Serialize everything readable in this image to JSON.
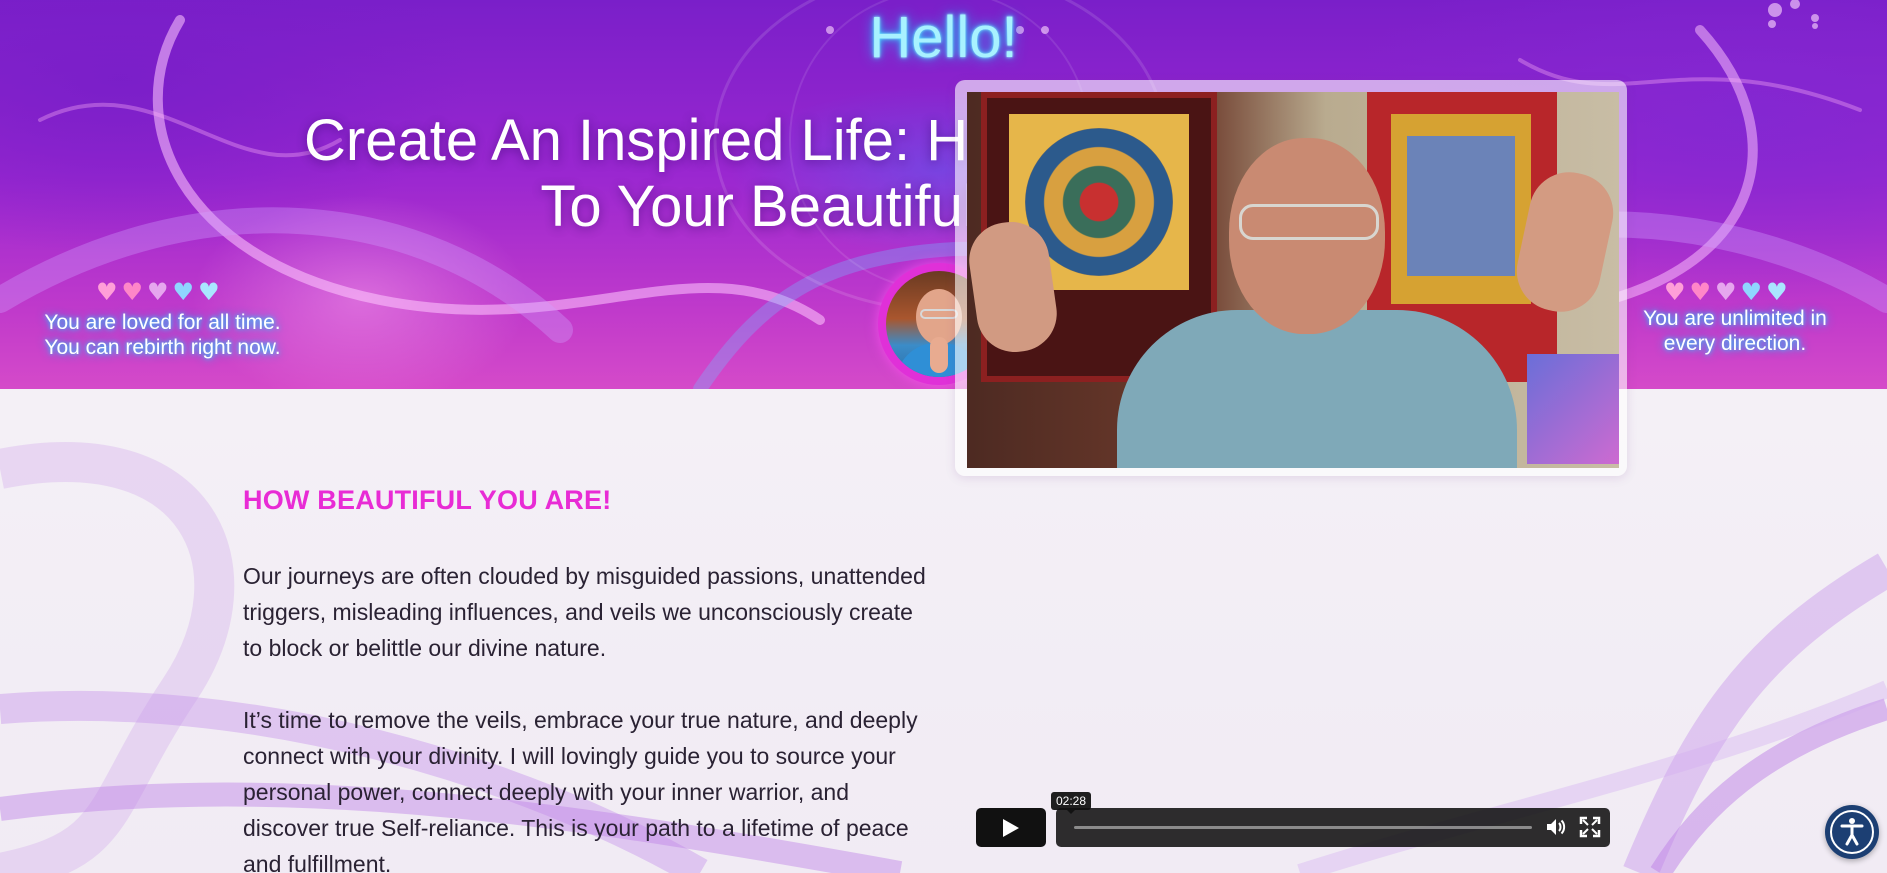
{
  "hero": {
    "greeting": "Hello!",
    "headline_line1": "Create An Inspired Life: Heal Your Past & Awaken",
    "headline_line2": "To Your Beautiful Authentic Self",
    "left_affirmation_line1": "You are loved for all time.",
    "left_affirmation_line2": "You can rebirth right now.",
    "right_affirmation_line1": "You are unlimited in",
    "right_affirmation_line2": "every direction.",
    "heart_colors": [
      "#ff9ed8",
      "#ff86c8",
      "#e6a6ee",
      "#8fd6ff",
      "#a9e6ff"
    ],
    "hearts_glyph": "♥"
  },
  "section": {
    "title": "HOW BEAUTIFUL YOU ARE!",
    "paragraph1": "Our journeys are often clouded by misguided passions, unattended triggers, misleading influences, and veils we unconsciously create to block or belittle our divine nature.",
    "paragraph2": "It’s time to remove the veils, embrace your true nature, and deeply connect with your divinity. I will lovingly guide you to source your personal power, connect deeply with your inner warrior, and discover true Self-reliance. This is your path to a lifetime of peace and fulfillment."
  },
  "video": {
    "duration": "02:28",
    "controls": [
      "play",
      "progress",
      "volume",
      "fullscreen"
    ]
  },
  "icons": {
    "accessibility": "accessibility-icon",
    "play": "play-icon",
    "volume": "volume-icon",
    "fullscreen": "fullscreen-icon"
  },
  "colors": {
    "accent_pink": "#e82bd5",
    "text_dark": "#2a2233",
    "accessibility_bg": "#1c3f73"
  }
}
